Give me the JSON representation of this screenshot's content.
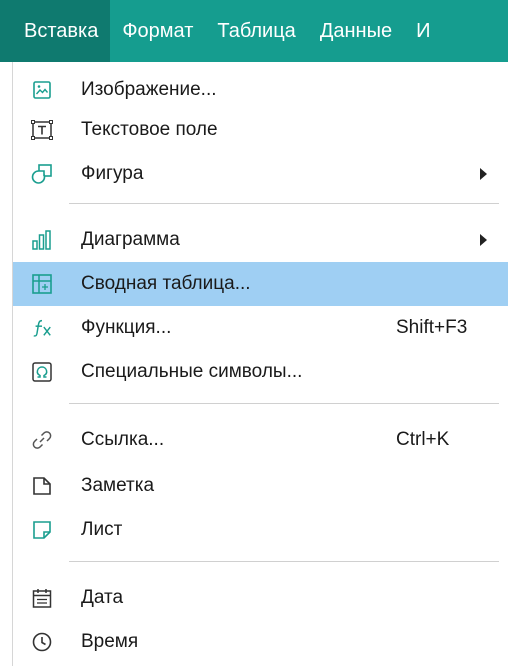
{
  "menubar": {
    "items": [
      {
        "label": "Вставка",
        "active": true
      },
      {
        "label": "Формат"
      },
      {
        "label": "Таблица"
      },
      {
        "label": "Данные"
      },
      {
        "label": "И"
      }
    ]
  },
  "colors": {
    "menubar_bg": "#159d8f",
    "menubar_active_bg": "#0f7a6f",
    "highlight_bg": "#9fcff3",
    "icon_teal": "#1a9e8f",
    "icon_dark": "#333333"
  },
  "menu": {
    "items": [
      {
        "label": "Изображение...",
        "icon": "image-icon"
      },
      {
        "label": "Текстовое поле",
        "icon": "text-box-icon"
      },
      {
        "label": "Фигура",
        "icon": "shapes-icon",
        "submenu": true
      },
      {
        "label": "Диаграмма",
        "icon": "chart-icon",
        "submenu": true
      },
      {
        "label": "Сводная таблица...",
        "icon": "pivot-table-icon",
        "highlighted": true
      },
      {
        "label": "Функция...",
        "icon": "function-icon",
        "shortcut": "Shift+F3"
      },
      {
        "label": "Специальные символы...",
        "icon": "omega-icon"
      },
      {
        "label": "Ссылка...",
        "icon": "link-icon",
        "shortcut": "Ctrl+K"
      },
      {
        "label": "Заметка",
        "icon": "note-icon"
      },
      {
        "label": "Лист",
        "icon": "sheet-icon"
      },
      {
        "label": "Дата",
        "icon": "calendar-icon"
      },
      {
        "label": "Время",
        "icon": "clock-icon"
      }
    ]
  }
}
